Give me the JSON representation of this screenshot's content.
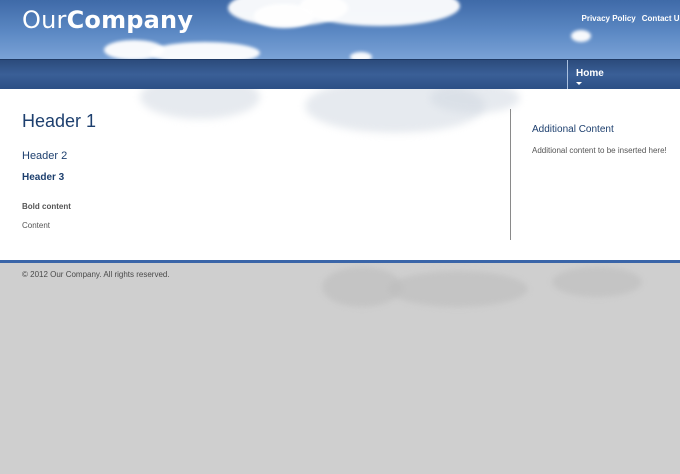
{
  "site": {
    "logo_light": "Our",
    "logo_bold": "Company"
  },
  "top_links": [
    {
      "label": "Privacy Policy"
    },
    {
      "label": "Contact Us"
    }
  ],
  "nav": {
    "items": [
      {
        "label": "Home"
      }
    ]
  },
  "main": {
    "header1": "Header 1",
    "header2": "Header 2",
    "header3": "Header 3",
    "bold_content": "Bold content",
    "content": "Content"
  },
  "sidebar": {
    "title": "Additional Content",
    "text": "Additional content to be inserted here!"
  },
  "footer": {
    "copyright": "© 2012 Our Company. All rights reserved."
  },
  "colors": {
    "header_sky": "#5c89c4",
    "navbar": "#3a5f97",
    "heading": "#1d3f6e",
    "footer_rule": "#3a65a8",
    "page_background": "#cfcfcf"
  }
}
